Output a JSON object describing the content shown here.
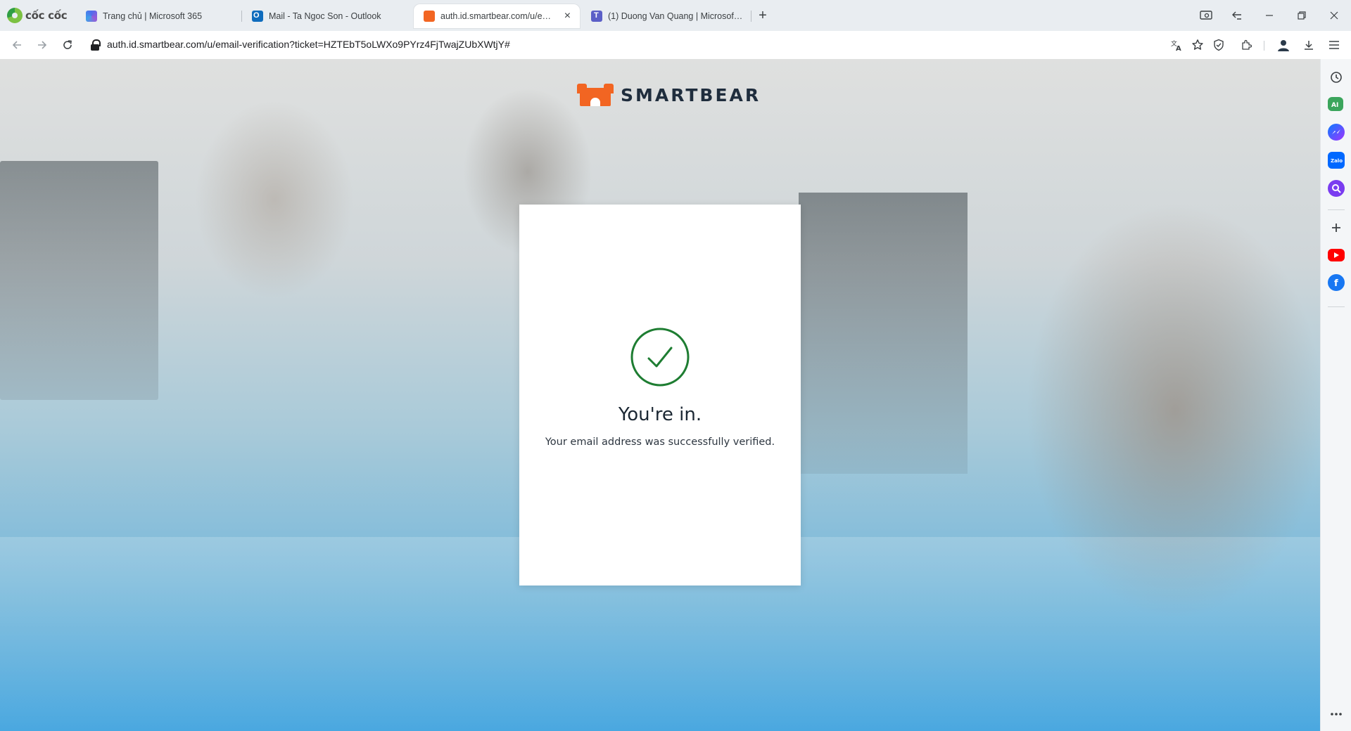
{
  "browser": {
    "brand": "cốc cốc",
    "tabs": [
      {
        "title": "Trang chủ | Microsoft 365",
        "icon": "microsoft-365-icon"
      },
      {
        "title": "Mail - Ta Ngoc Son - Outlook",
        "icon": "outlook-icon"
      },
      {
        "title": "auth.id.smartbear.com/u/email-",
        "icon": "smartbear-icon",
        "active": true
      },
      {
        "title": "(1) Duong Van Quang | Microsoft Te",
        "icon": "teams-icon"
      }
    ],
    "new_tab": "+",
    "close_tab": "×",
    "url": "auth.id.smartbear.com/u/email-verification?ticket=HZTEbT5oLWXo9PYrz4FjTwajZUbXWtjY#"
  },
  "page": {
    "logo_text": "SMARTBEAR",
    "card": {
      "title": "You're in.",
      "subtitle": "Your email address was successfully verified."
    }
  },
  "colors": {
    "brand_orange": "#f26522",
    "success_green": "#1e7d32",
    "logo_text": "#1f2d3d"
  }
}
